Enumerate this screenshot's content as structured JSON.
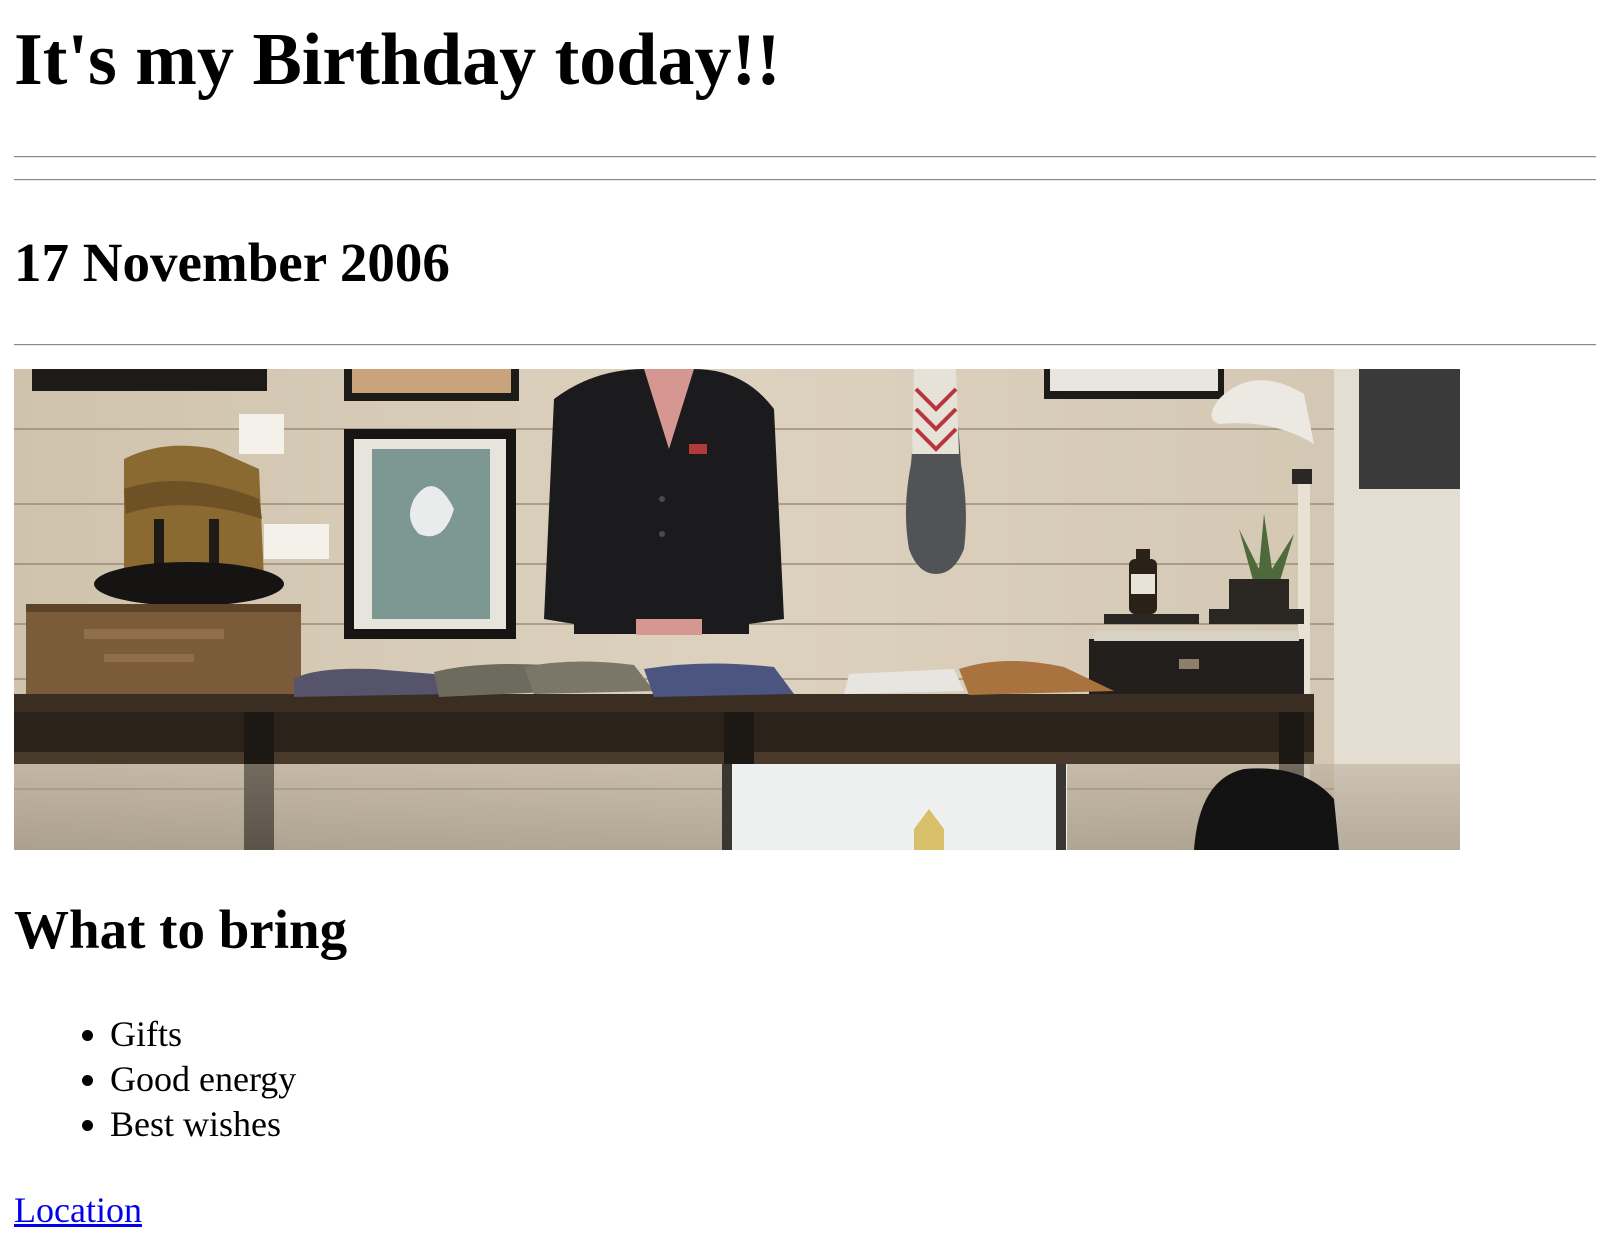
{
  "header": {
    "title": "It's my Birthday today!!"
  },
  "event": {
    "date": "17 November 2006"
  },
  "hero_image": {
    "description_name": "shop-display-photo"
  },
  "bring": {
    "heading": "What to bring",
    "items": [
      {
        "label": "Gifts"
      },
      {
        "label": "Good energy"
      },
      {
        "label": "Best wishes"
      }
    ]
  },
  "footer": {
    "location_label": "Location"
  },
  "colors": {
    "link": "#0000ee",
    "rule": "#8a8a8a",
    "text": "#000000",
    "background": "#ffffff"
  }
}
